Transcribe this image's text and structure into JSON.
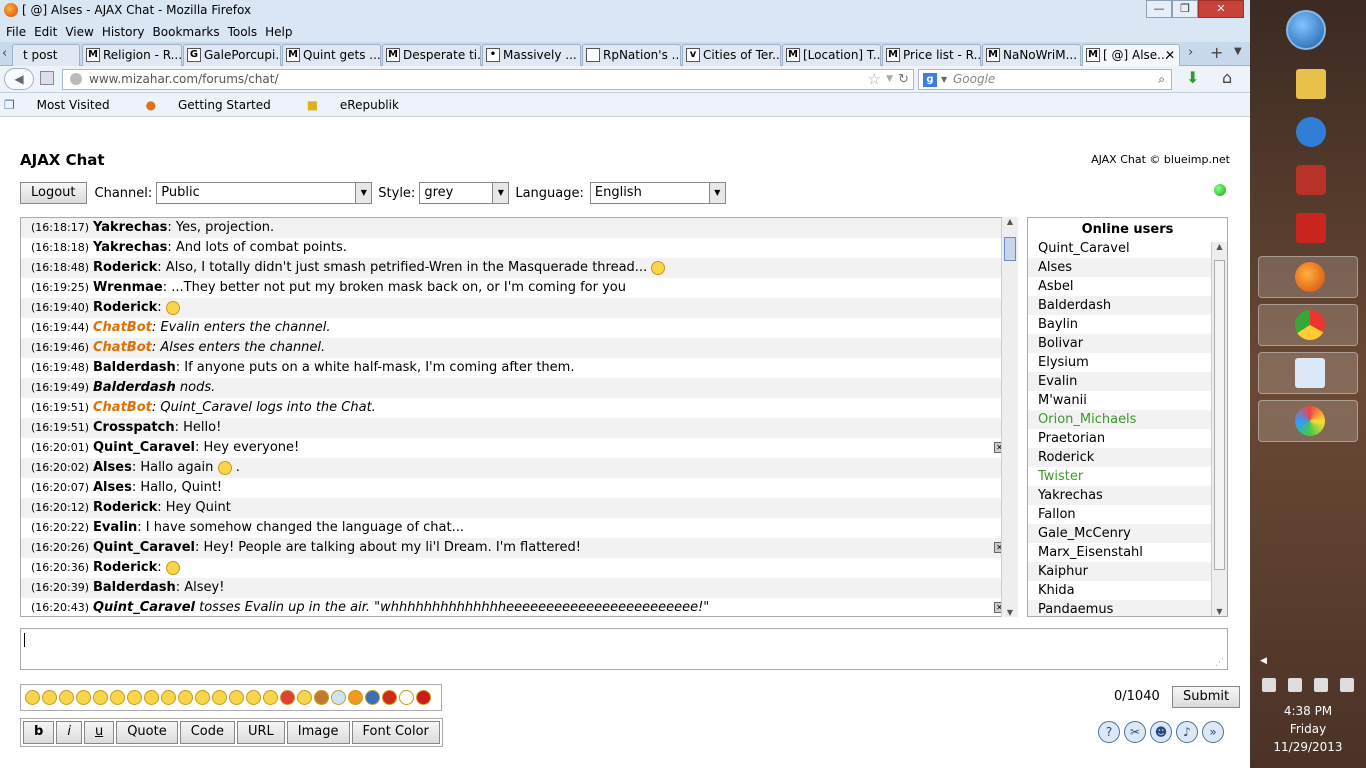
{
  "window": {
    "title": "[ @] Alses - AJAX Chat - Mozilla Firefox"
  },
  "menu": [
    "File",
    "Edit",
    "View",
    "History",
    "Bookmarks",
    "Tools",
    "Help"
  ],
  "tabs": [
    {
      "label": "t post",
      "icon": "M"
    },
    {
      "label": "Religion - R...",
      "icon": "M"
    },
    {
      "label": "GalePorcupi...",
      "icon": "G"
    },
    {
      "label": "Quint gets ...",
      "icon": "M"
    },
    {
      "label": "Desperate ti...",
      "icon": "M"
    },
    {
      "label": "Massively ...",
      "icon": "•"
    },
    {
      "label": "RpNation's ...",
      "icon": ""
    },
    {
      "label": "Cities of Ter...",
      "icon": "v"
    },
    {
      "label": "[Location] T...",
      "icon": "M"
    },
    {
      "label": "Price list - R...",
      "icon": "M"
    },
    {
      "label": "NaNoWriM...",
      "icon": "M"
    },
    {
      "label": "[ @] Alse...",
      "icon": "M"
    }
  ],
  "nav": {
    "url": "www.mizahar.com/forums/chat/",
    "search_placeholder": "Google"
  },
  "bookmarks": [
    "Most Visited",
    "Getting Started",
    "eRepublik"
  ],
  "chat": {
    "title": "AJAX Chat",
    "copyright": "AJAX Chat © blueimp.net",
    "logout": "Logout",
    "channel_label": "Channel:",
    "channel": "Public",
    "style_label": "Style:",
    "style": "grey",
    "language_label": "Language:",
    "language": "English",
    "online_title": "Online users",
    "counter": "0/1040",
    "submit": "Submit",
    "bbcode": [
      "b",
      "i",
      "u",
      "Quote",
      "Code",
      "URL",
      "Image",
      "Font Color"
    ]
  },
  "messages": [
    {
      "time": "(16:18:17)",
      "user": "Yakrechas",
      "text": ": Yes, projection.",
      "kind": "normal"
    },
    {
      "time": "(16:18:18)",
      "user": "Yakrechas",
      "text": ": And lots of combat points.",
      "kind": "normal"
    },
    {
      "time": "(16:18:48)",
      "user": "Roderick",
      "text": ": Also, I totally didn't just smash petrified-Wren in the Masquerade thread...",
      "kind": "normal",
      "emoji": true
    },
    {
      "time": "(16:19:25)",
      "user": "Wrenmae",
      "text": ": ...They better not put my broken mask back on, or I'm coming for you",
      "kind": "normal"
    },
    {
      "time": "(16:19:40)",
      "user": "Roderick",
      "text": ":",
      "kind": "normal",
      "emoji": true
    },
    {
      "time": "(16:19:44)",
      "user": "ChatBot",
      "text": ": Evalin enters the channel.",
      "kind": "bot"
    },
    {
      "time": "(16:19:46)",
      "user": "ChatBot",
      "text": ": Alses enters the channel.",
      "kind": "bot"
    },
    {
      "time": "(16:19:48)",
      "user": "Balderdash",
      "text": ": If anyone puts on a white half-mask, I'm coming after them.",
      "kind": "normal"
    },
    {
      "time": "(16:19:49)",
      "user": "Balderdash",
      "text": " nods.",
      "kind": "action"
    },
    {
      "time": "(16:19:51)",
      "user": "ChatBot",
      "text": ": Quint_Caravel logs into the Chat.",
      "kind": "bot"
    },
    {
      "time": "(16:19:51)",
      "user": "Crosspatch",
      "text": ": Hello!",
      "kind": "normal"
    },
    {
      "time": "(16:20:01)",
      "user": "Quint_Caravel",
      "text": ": Hey everyone!",
      "kind": "normal",
      "deletable": true
    },
    {
      "time": "(16:20:02)",
      "user": "Alses",
      "text": ": Hallo again",
      "kind": "normal",
      "emoji": true,
      "suffix": " ."
    },
    {
      "time": "(16:20:07)",
      "user": "Alses",
      "text": ": Hallo, Quint!",
      "kind": "normal"
    },
    {
      "time": "(16:20:12)",
      "user": "Roderick",
      "text": ": Hey Quint",
      "kind": "normal"
    },
    {
      "time": "(16:20:22)",
      "user": "Evalin",
      "text": ": I have somehow changed the language of chat...",
      "kind": "normal"
    },
    {
      "time": "(16:20:26)",
      "user": "Quint_Caravel",
      "text": ": Hey! People are talking about my li'l Dream. I'm flattered!",
      "kind": "normal",
      "deletable": true
    },
    {
      "time": "(16:20:36)",
      "user": "Roderick",
      "text": ":",
      "kind": "normal",
      "emoji": true
    },
    {
      "time": "(16:20:39)",
      "user": "Balderdash",
      "text": ": Alsey!",
      "kind": "normal"
    },
    {
      "time": "(16:20:43)",
      "user": "Quint_Caravel",
      "text": " tosses Evalin up in the air. \"whhhhhhhhhhhhhheeeeeeeeeeeeeeeeeeeeeeee!\"",
      "kind": "action",
      "deletable": true
    }
  ],
  "users": [
    {
      "name": "Quint_Caravel",
      "green": false
    },
    {
      "name": "Alses",
      "green": false
    },
    {
      "name": "Asbel",
      "green": false
    },
    {
      "name": "Balderdash",
      "green": false
    },
    {
      "name": "Baylin",
      "green": false
    },
    {
      "name": "Bolivar",
      "green": false
    },
    {
      "name": "Elysium",
      "green": false
    },
    {
      "name": "Evalin",
      "green": false
    },
    {
      "name": "M'wanii",
      "green": false
    },
    {
      "name": "Orion_Michaels",
      "green": true
    },
    {
      "name": "Praetorian",
      "green": false
    },
    {
      "name": "Roderick",
      "green": false
    },
    {
      "name": "Twister",
      "green": true
    },
    {
      "name": "Yakrechas",
      "green": false
    },
    {
      "name": "Fallon",
      "green": false
    },
    {
      "name": "Gale_McCenry",
      "green": false
    },
    {
      "name": "Marx_Eisenstahl",
      "green": false
    },
    {
      "name": "Kaiphur",
      "green": false
    },
    {
      "name": "Khida",
      "green": false
    },
    {
      "name": "Pandaemus",
      "green": false
    }
  ],
  "taskbar": {
    "time": "4:38 PM",
    "day": "Friday",
    "date": "11/29/2013"
  }
}
